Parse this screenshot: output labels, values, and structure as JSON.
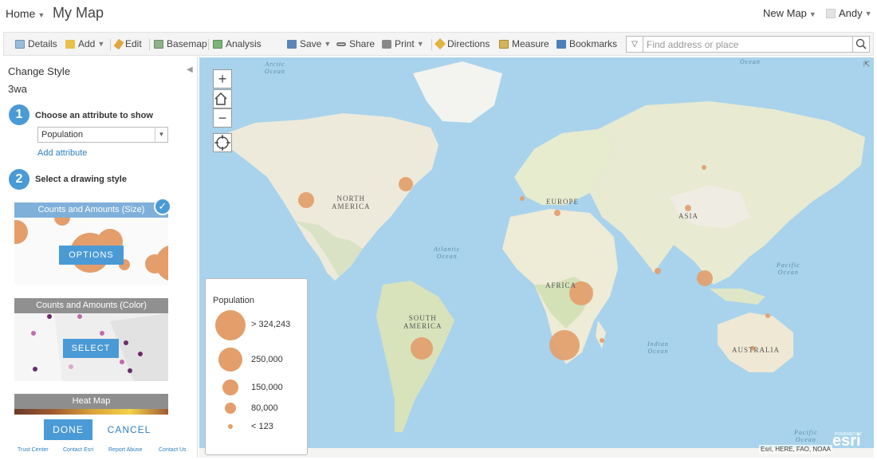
{
  "header": {
    "home_label": "Home",
    "map_title": "My Map",
    "new_map_label": "New Map",
    "user_name": "Andy"
  },
  "toolbar": {
    "details": "Details",
    "add": "Add",
    "edit": "Edit",
    "basemap": "Basemap",
    "analysis": "Analysis",
    "save": "Save",
    "share": "Share",
    "print": "Print",
    "directions": "Directions",
    "measure": "Measure",
    "bookmarks": "Bookmarks",
    "search_placeholder": "Find address or place"
  },
  "panel": {
    "title": "Change Style",
    "layer_name": "3wa",
    "step1_num": "1",
    "step1_label": "Choose an attribute to show",
    "attribute_value": "Population",
    "add_attribute": "Add attribute",
    "step2_num": "2",
    "step2_label": "Select a drawing style",
    "styles": [
      {
        "title": "Counts and Amounts (Size)",
        "button": "OPTIONS",
        "selected": true
      },
      {
        "title": "Counts and Amounts (Color)",
        "button": "SELECT",
        "selected": false
      },
      {
        "title": "Heat Map",
        "button": "",
        "selected": false
      }
    ],
    "done": "DONE",
    "cancel": "CANCEL",
    "footer_links": [
      "Trust Center",
      "Contact Esri",
      "Report Abuse",
      "Contact Us"
    ]
  },
  "map": {
    "labels": {
      "north_america": [
        "NORTH",
        "AMERICA"
      ],
      "south_america": [
        "SOUTH",
        "AMERICA"
      ],
      "europe": "EUROPE",
      "asia": "ASIA",
      "africa": "AFRICA",
      "australia": "AUSTRALIA"
    },
    "oceans": {
      "arctic": [
        "Arctic",
        "Ocean"
      ],
      "atlantic": [
        "Atlantic",
        "Ocean"
      ],
      "indian": [
        "Indian",
        "Ocean"
      ],
      "pacific_east": [
        "Pacific",
        "Ocean"
      ],
      "pacific_south": [
        "Pacific",
        "Ocean"
      ],
      "ocean_top": "Ocean"
    },
    "attribution": "Esri, HERE, FAO, NOAA",
    "logo": "esri",
    "logo_powered": "POWERED BY",
    "symbol_color": "#e39e6b",
    "zoom_in": "+",
    "zoom_out": "−"
  },
  "legend": {
    "title": "Population",
    "items": [
      "> 324,243",
      "250,000",
      "150,000",
      "80,000",
      "< 123"
    ]
  },
  "colors": {
    "accent": "#4a9ad6",
    "symbol": "#e39e6b",
    "water": "#a9d3ec",
    "land": "#f1efe6"
  }
}
